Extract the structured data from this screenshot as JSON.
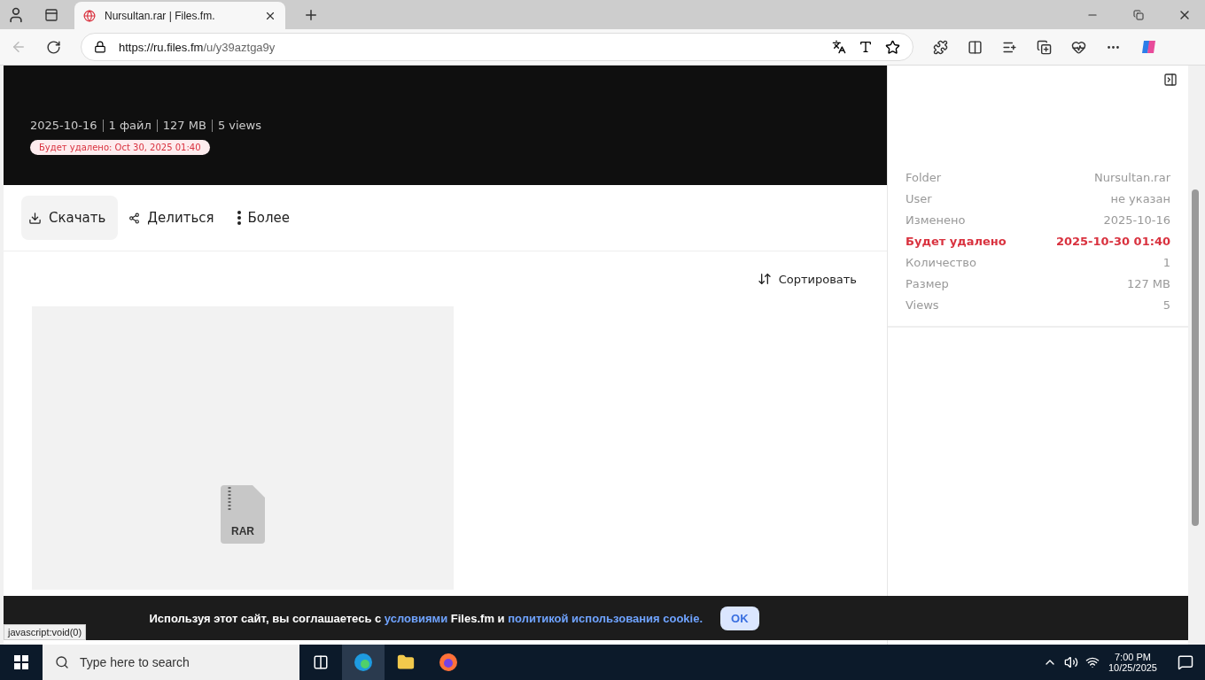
{
  "browser": {
    "tab": {
      "title": "Nursultan.rar | Files.fm.",
      "selected": true
    },
    "url_host": "https://ru.files.fm",
    "url_path": "/u/y39aztga9y"
  },
  "header": {
    "meta": [
      "2025-10-16",
      "1 файл",
      "127 MB",
      "5 views"
    ],
    "badge": "Будет удалено: Oct 30, 2025 01:40"
  },
  "actions": [
    {
      "label": "Скачать",
      "kind": "download",
      "selected": true
    },
    {
      "label": "Делиться",
      "kind": "share",
      "selected": false
    },
    {
      "label": "Более",
      "kind": "more",
      "selected": false
    }
  ],
  "sort": {
    "label": "Сортировать"
  },
  "file": {
    "ext": "RAR"
  },
  "details": [
    {
      "label": "Folder",
      "value": "Nursultan.rar",
      "warning": false
    },
    {
      "label": "User",
      "value": "не указан",
      "warning": false
    },
    {
      "label": "Изменено",
      "value": "2025-10-16",
      "warning": false
    },
    {
      "label": "Будет удалено",
      "value": "2025-10-30 01:40",
      "warning": true
    },
    {
      "label": "Количество",
      "value": "1",
      "warning": false
    },
    {
      "label": "Размер",
      "value": "127 MB",
      "warning": false
    },
    {
      "label": "Views",
      "value": "5",
      "warning": false
    }
  ],
  "cookie": {
    "parts": [
      {
        "kind": "text",
        "text": "Используя этот сайт, вы соглашаетесь с "
      },
      {
        "kind": "link",
        "text": "условиями"
      },
      {
        "kind": "text",
        "text": " Files.fm и "
      },
      {
        "kind": "link",
        "text": "политикой использования cookie."
      }
    ],
    "button": "OK"
  },
  "status": "javascript:void(0)",
  "taskbar": {
    "search_placeholder": "Type here to search",
    "time": "7:00 PM",
    "date": "10/25/2025"
  }
}
